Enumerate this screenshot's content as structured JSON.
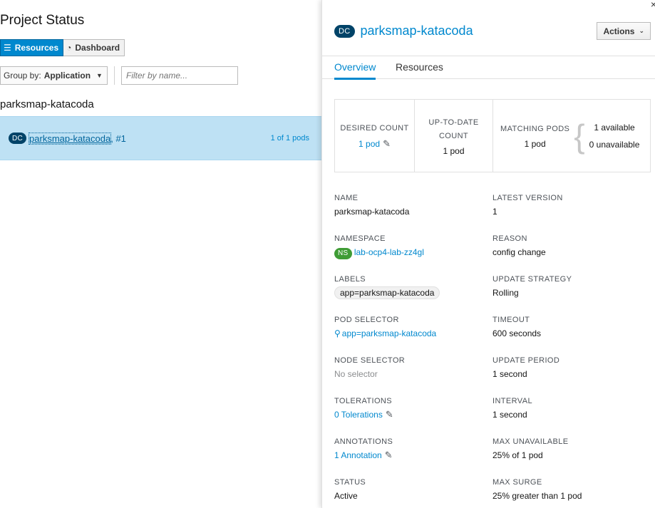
{
  "left": {
    "title": "Project Status",
    "view_toggle": {
      "resources": "Resources",
      "dashboard": "Dashboard"
    },
    "group_by": {
      "label": "Group by:",
      "value": "Application"
    },
    "filter_placeholder": "Filter by name...",
    "group_heading": "parksmap-katacoda",
    "resource_row": {
      "badge": "DC",
      "name": "parksmap-katacoda",
      "build": ", #1",
      "pods": "1 of 1 pods"
    }
  },
  "right": {
    "close": "×",
    "badge": "DC",
    "title": "parksmap-katacoda",
    "actions_label": "Actions",
    "tabs": [
      "Overview",
      "Resources"
    ],
    "stats": {
      "desired_label": "DESIRED COUNT",
      "desired_value": "1 pod",
      "uptodate_label": "UP-TO-DATE COUNT",
      "uptodate_value": "1 pod",
      "matching_label": "MATCHING PODS",
      "matching_value": "1 pod",
      "available": "1 available",
      "unavailable": "0 unavailable"
    },
    "details_left": [
      {
        "label": "NAME",
        "value": "parksmap-katacoda"
      },
      {
        "label": "NAMESPACE",
        "badge": "NS",
        "value": "lab-ocp4-lab-zz4gl"
      },
      {
        "label": "LABELS",
        "value": "app=parksmap-katacoda"
      },
      {
        "label": "POD SELECTOR",
        "value": "app=parksmap-katacoda"
      },
      {
        "label": "NODE SELECTOR",
        "value": "No selector"
      },
      {
        "label": "TOLERATIONS",
        "value": "0 Tolerations"
      },
      {
        "label": "ANNOTATIONS",
        "value": "1 Annotation"
      },
      {
        "label": "STATUS",
        "value": "Active"
      }
    ],
    "details_right": [
      {
        "label": "LATEST VERSION",
        "value": "1"
      },
      {
        "label": "REASON",
        "value": "config change"
      },
      {
        "label": "UPDATE STRATEGY",
        "value": "Rolling"
      },
      {
        "label": "TIMEOUT",
        "value": "600 seconds"
      },
      {
        "label": "UPDATE PERIOD",
        "value": "1 second"
      },
      {
        "label": "INTERVAL",
        "value": "1 second"
      },
      {
        "label": "MAX UNAVAILABLE",
        "value": "25% of 1 pod"
      },
      {
        "label": "MAX SURGE",
        "value": "25% greater than 1 pod"
      }
    ]
  }
}
